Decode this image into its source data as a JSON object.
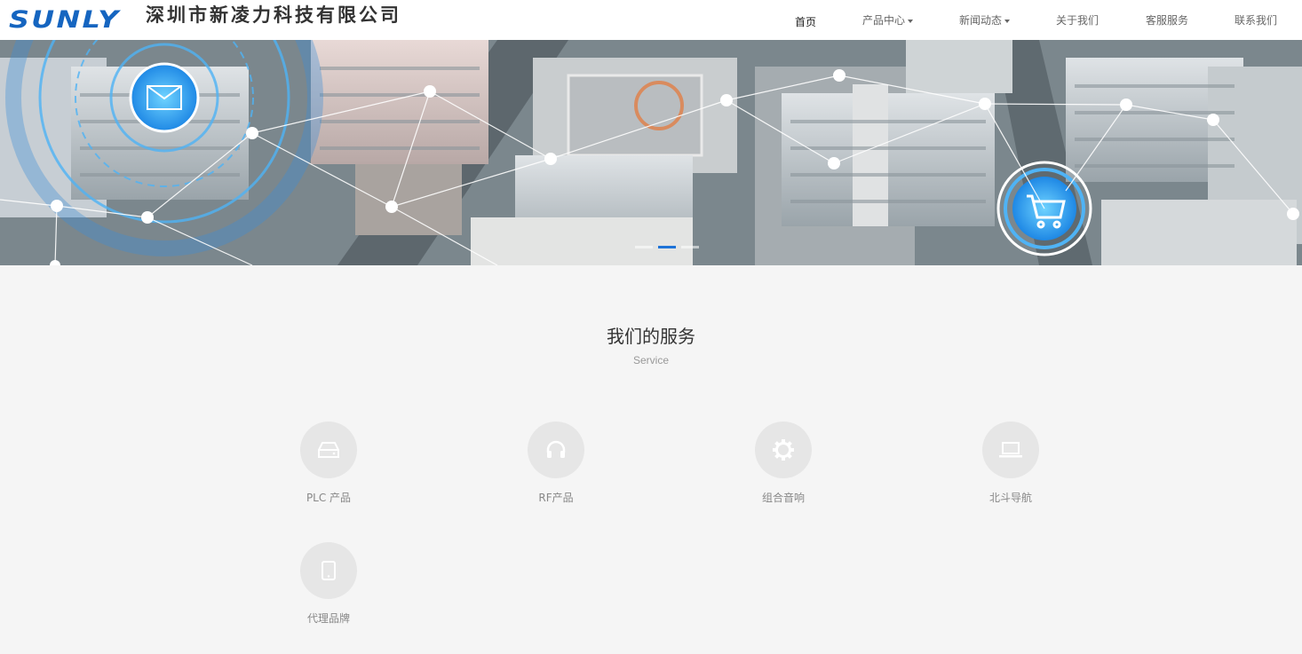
{
  "header": {
    "brand": "SUNLY",
    "company": "深圳市新凌力科技有限公司",
    "nav": [
      {
        "label": "首页",
        "active": true
      },
      {
        "label": "产品中心",
        "dropdown": true
      },
      {
        "label": "新闻动态",
        "dropdown": true
      },
      {
        "label": "关于我们"
      },
      {
        "label": "客服服务"
      },
      {
        "label": "联系我们"
      }
    ]
  },
  "banner": {
    "slides": 3,
    "active_slide": 2,
    "icons": [
      "mail-icon",
      "shopping-cart-icon"
    ]
  },
  "services": {
    "title": "我们的服务",
    "subtitle": "Service",
    "items": [
      {
        "label": "PLC 产品",
        "icon": "hard-drive-icon"
      },
      {
        "label": "RF产品",
        "icon": "headphones-icon"
      },
      {
        "label": "组合音响",
        "icon": "gear-icon"
      },
      {
        "label": "北斗导航",
        "icon": "laptop-icon"
      },
      {
        "label": "代理品牌",
        "icon": "tablet-icon"
      }
    ]
  },
  "colors": {
    "brand": "#1565c0",
    "background": "#f5f5f5",
    "icon_circle": "#e6e6e6",
    "active_indicator": "#1e73d8"
  }
}
